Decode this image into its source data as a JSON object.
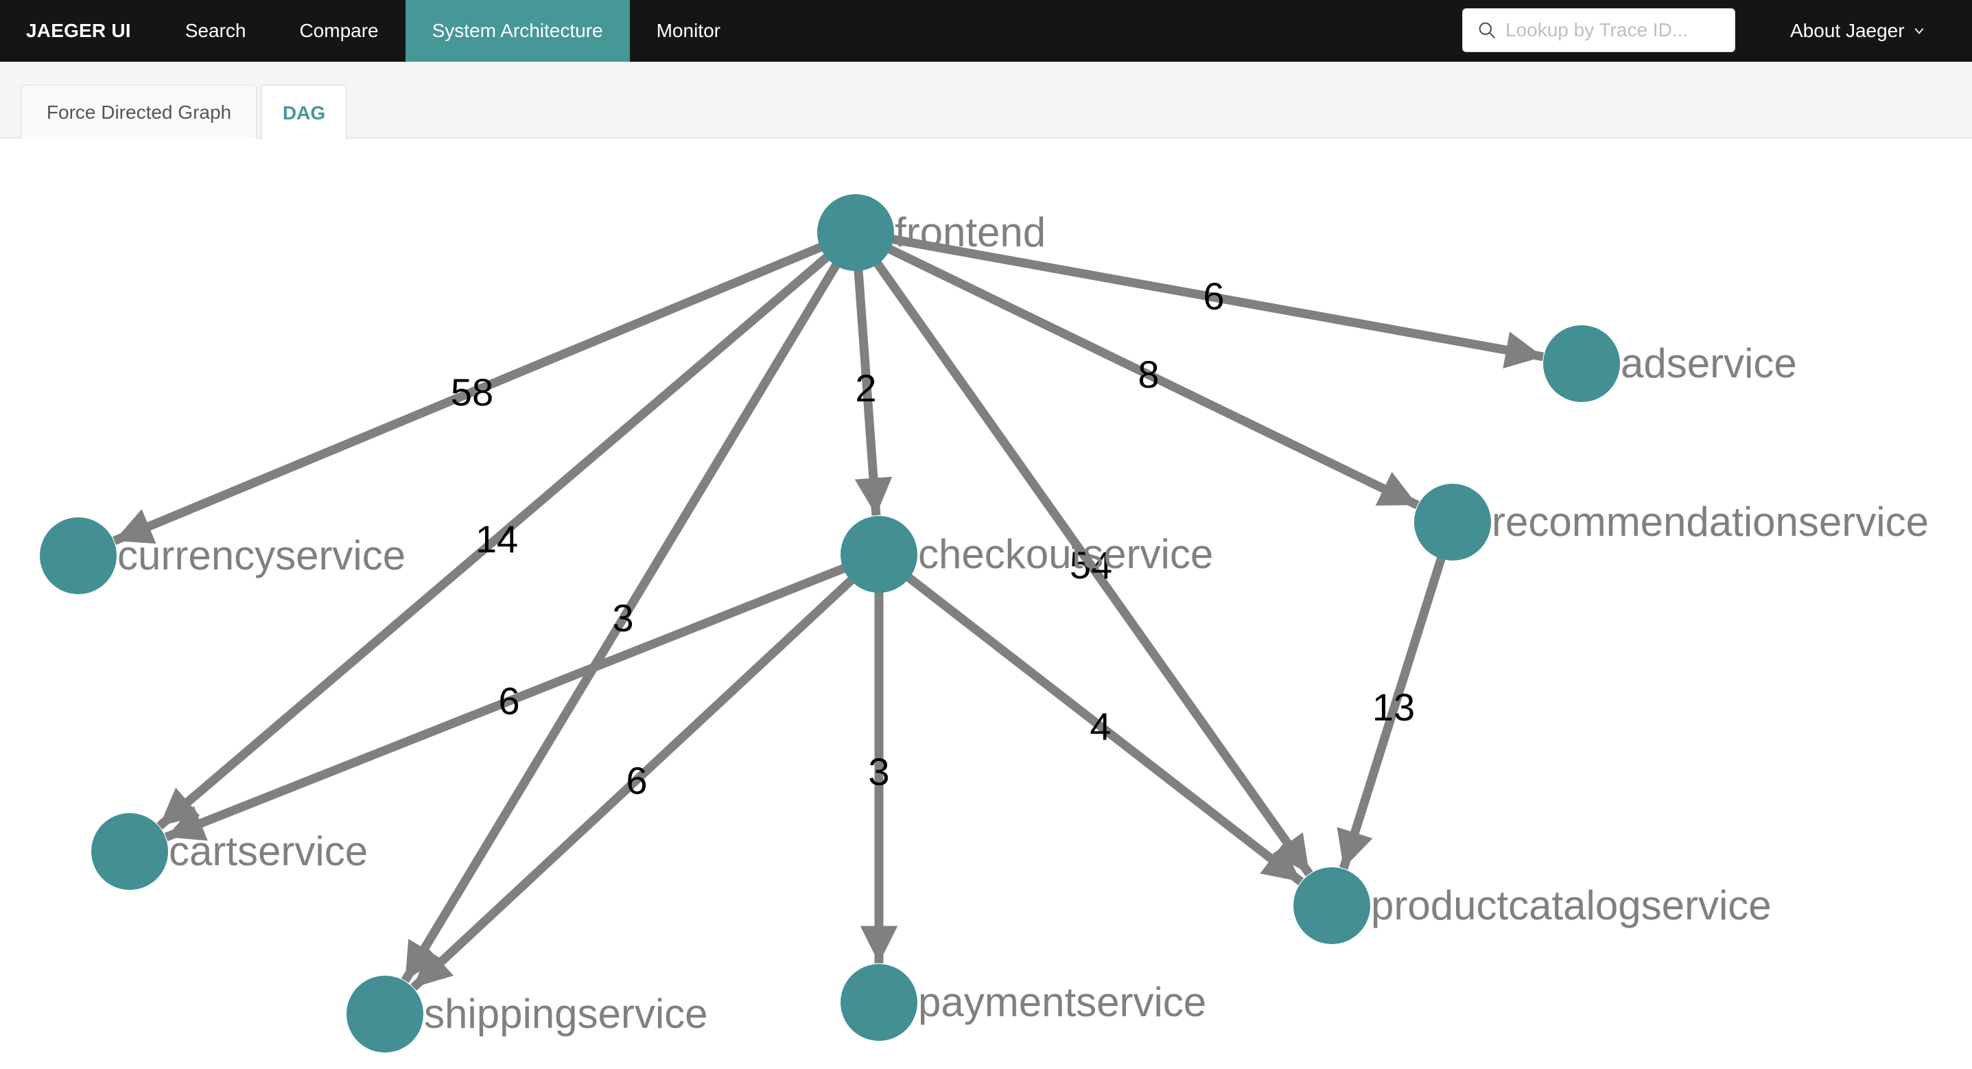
{
  "nav": {
    "brand": "JAEGER UI",
    "items": [
      {
        "label": "Search",
        "active": false
      },
      {
        "label": "Compare",
        "active": false
      },
      {
        "label": "System Architecture",
        "active": true
      },
      {
        "label": "Monitor",
        "active": false
      }
    ],
    "search_placeholder": "Lookup by Trace ID...",
    "search_value": "",
    "search_icon": "search-icon",
    "about_label": "About Jaeger",
    "about_icon": "chevron-down-icon"
  },
  "tabs": [
    {
      "label": "Force Directed Graph",
      "active": false
    },
    {
      "label": "DAG",
      "active": true
    }
  ],
  "colors": {
    "nav_bg": "#151515",
    "accent": "#459798",
    "node_fill": "#438f94",
    "edge": "#808080",
    "node_label": "#808080",
    "edge_label": "#000000"
  },
  "graph": {
    "nodes": [
      {
        "id": "frontend",
        "label": "frontend"
      },
      {
        "id": "adservice",
        "label": "adservice"
      },
      {
        "id": "recommendationservice",
        "label": "recommendationservice"
      },
      {
        "id": "currencyservice",
        "label": "currencyservice"
      },
      {
        "id": "checkoutservice",
        "label": "checkoutservice"
      },
      {
        "id": "cartservice",
        "label": "cartservice"
      },
      {
        "id": "productcatalogservice",
        "label": "productcatalogservice"
      },
      {
        "id": "shippingservice",
        "label": "shippingservice"
      },
      {
        "id": "paymentservice",
        "label": "paymentservice"
      }
    ],
    "edges": [
      {
        "from": "frontend",
        "to": "currencyservice",
        "calls": "58"
      },
      {
        "from": "frontend",
        "to": "cartservice",
        "calls": "14"
      },
      {
        "from": "frontend",
        "to": "shippingservice",
        "calls": "3"
      },
      {
        "from": "frontend",
        "to": "checkoutservice",
        "calls": "2"
      },
      {
        "from": "frontend",
        "to": "productcatalogservice",
        "calls": "54"
      },
      {
        "from": "frontend",
        "to": "recommendationservice",
        "calls": "8"
      },
      {
        "from": "frontend",
        "to": "adservice",
        "calls": "6"
      },
      {
        "from": "recommendationservice",
        "to": "productcatalogservice",
        "calls": "13"
      },
      {
        "from": "checkoutservice",
        "to": "cartservice",
        "calls": "6"
      },
      {
        "from": "checkoutservice",
        "to": "shippingservice",
        "calls": "6"
      },
      {
        "from": "checkoutservice",
        "to": "paymentservice",
        "calls": "3"
      },
      {
        "from": "checkoutservice",
        "to": "productcatalogservice",
        "calls": "4"
      }
    ]
  }
}
